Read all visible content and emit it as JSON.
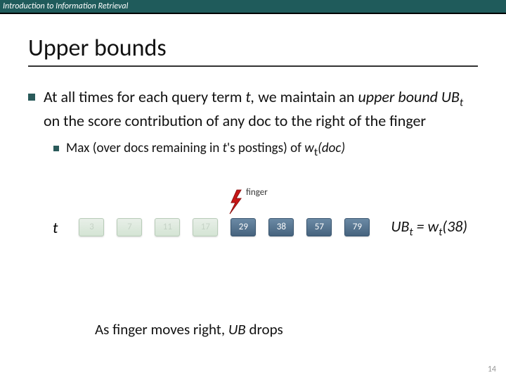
{
  "header": "Introduction to Information Retrieval",
  "title": "Upper bounds",
  "bullet1_pre": "At all times for each query term ",
  "bullet1_t": "t,",
  "bullet1_mid": " we maintain an ",
  "bullet1_upper": "upper bound UB",
  "bullet1_sub": "t",
  "bullet1_post": " on the score contribution of any doc to the right of the finger",
  "bullet2_pre": "Max (over docs remaining in ",
  "bullet2_t": "t",
  "bullet2_mid": "'s postings) of ",
  "bullet2_w": "w",
  "bullet2_wsub": "t",
  "bullet2_doc": "(doc)",
  "finger_label": "finger",
  "t_label": "t",
  "postings": {
    "washed": [
      "3",
      "7",
      "11",
      "17"
    ],
    "active": [
      "29",
      "38",
      "57",
      "79"
    ]
  },
  "ub_eq_lhs": "UB",
  "ub_eq_lhs_sub": "t",
  "ub_eq_mid": " = w",
  "ub_eq_rhs_sub": "t",
  "ub_eq_arg": "(38)",
  "caption_pre": "As finger moves right, ",
  "caption_ub": "UB",
  "caption_post": " drops",
  "page_number": "14"
}
